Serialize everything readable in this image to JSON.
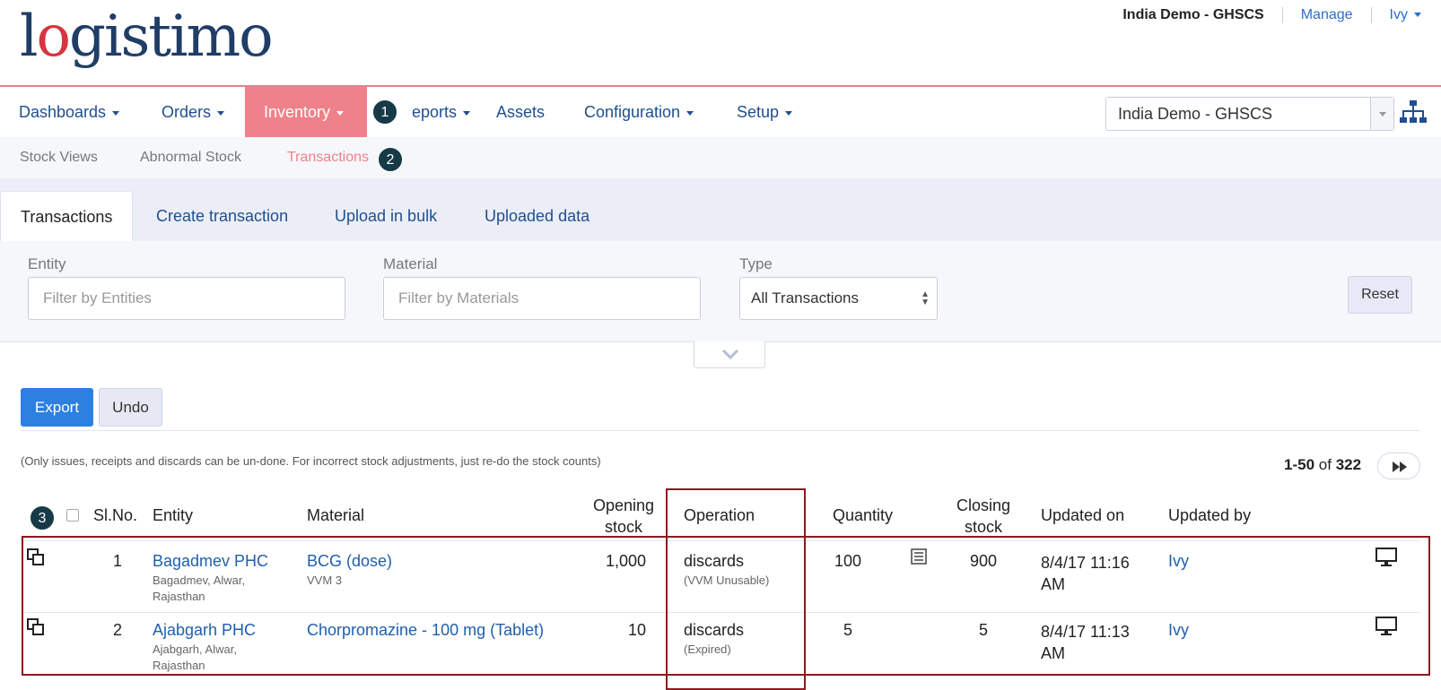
{
  "header": {
    "logo_text_a": "l",
    "logo_text_b": "o",
    "logo_text_c": "gistimo",
    "org_name": "India Demo - GHSCS",
    "manage": "Manage",
    "user": "Ivy"
  },
  "nav": {
    "items": [
      "Dashboards",
      "Orders",
      "Inventory",
      "eports",
      "Assets",
      "Configuration",
      "Setup"
    ],
    "org_select": "India Demo - GHSCS"
  },
  "subnav": {
    "items": [
      "Stock Views",
      "Abnormal Stock",
      "Transactions"
    ]
  },
  "badges": [
    "1",
    "2",
    "3"
  ],
  "tabs": [
    "Transactions",
    "Create transaction",
    "Upload in bulk",
    "Uploaded data"
  ],
  "filters": {
    "entity_label": "Entity",
    "entity_placeholder": "Filter by Entities",
    "material_label": "Material",
    "material_placeholder": "Filter by Materials",
    "type_label": "Type",
    "type_value": "All Transactions",
    "reset": "Reset"
  },
  "actions": {
    "export": "Export",
    "undo": "Undo"
  },
  "note": "(Only issues, receipts and discards can be un-done. For incorrect stock adjustments, just re-do the stock counts)",
  "pager": {
    "range": "1-50",
    "of": "of",
    "total": "322"
  },
  "table": {
    "headers": {
      "slno": "Sl.No.",
      "entity": "Entity",
      "material": "Material",
      "opening_1": "Opening",
      "opening_2": "stock",
      "operation": "Operation",
      "quantity": "Quantity",
      "closing_1": "Closing",
      "closing_2": "stock",
      "updated_on": "Updated on",
      "updated_by": "Updated by"
    },
    "rows": [
      {
        "slno": "1",
        "entity": "Bagadmev PHC",
        "entity_loc_1": "Bagadmev, Alwar,",
        "entity_loc_2": "Rajasthan",
        "material": "BCG (dose)",
        "material_sub": "VVM 3",
        "opening": "1,000",
        "operation": "discards",
        "reason": "(VVM Unusable)",
        "quantity": "100",
        "closing": "900",
        "updated_on_1": "8/4/17 11:16",
        "updated_on_2": "AM",
        "updated_by": "Ivy"
      },
      {
        "slno": "2",
        "entity": "Ajabgarh PHC",
        "entity_loc_1": "Ajabgarh, Alwar,",
        "entity_loc_2": "Rajasthan",
        "material": "Chorpromazine - 100 mg (Tablet)",
        "material_sub": "",
        "opening": "10",
        "operation": "discards",
        "reason": "(Expired)",
        "quantity": "5",
        "closing": "5",
        "updated_on_1": "8/4/17 11:13",
        "updated_on_2": "AM",
        "updated_by": "Ivy"
      }
    ]
  },
  "colors": {
    "accent": "#ee8189",
    "link": "#1f5fae",
    "primary_button": "#2d7fe0",
    "highlight": "#8b1a1f"
  }
}
